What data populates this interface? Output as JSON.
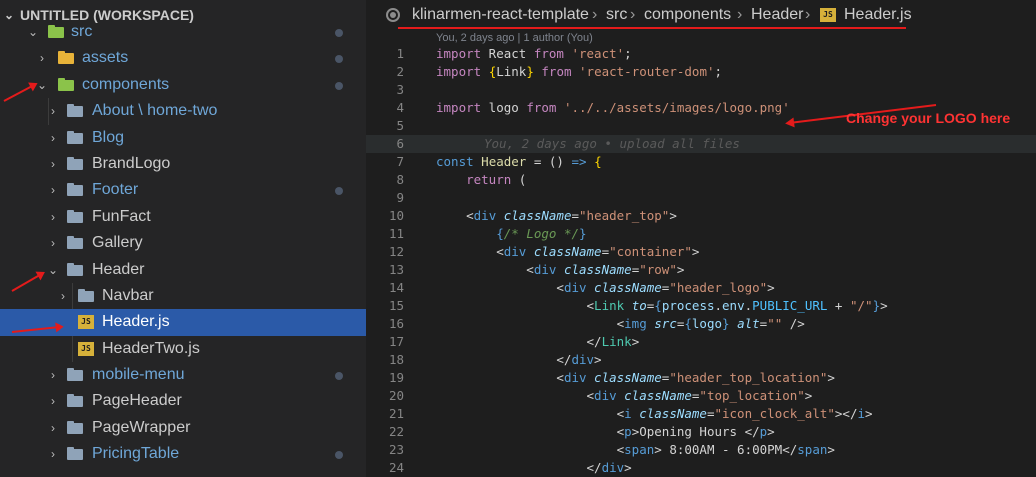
{
  "sidebar": {
    "workspace_title": "UNTITLED (WORKSPACE)",
    "items": [
      {
        "label": "src",
        "kind": "folder",
        "color": "green",
        "expanded": true,
        "level": 1
      },
      {
        "label": "assets",
        "kind": "folder",
        "color": "yellow",
        "expanded": false,
        "level": 2
      },
      {
        "label": "components",
        "kind": "folder",
        "color": "green",
        "expanded": true,
        "level": 2
      },
      {
        "label": "About \\ home-two",
        "kind": "folder",
        "expanded": false,
        "level": 3
      },
      {
        "label": "Blog",
        "kind": "folder",
        "expanded": false,
        "level": 3
      },
      {
        "label": "BrandLogo",
        "kind": "folder",
        "expanded": false,
        "level": 3
      },
      {
        "label": "Footer",
        "kind": "folder",
        "expanded": false,
        "level": 3
      },
      {
        "label": "FunFact",
        "kind": "folder",
        "expanded": false,
        "level": 3
      },
      {
        "label": "Gallery",
        "kind": "folder",
        "expanded": false,
        "level": 3
      },
      {
        "label": "Header",
        "kind": "folder",
        "expanded": true,
        "level": 3
      },
      {
        "label": "Navbar",
        "kind": "folder",
        "expanded": false,
        "level": 4
      },
      {
        "label": "Header.js",
        "kind": "js",
        "level": 4
      },
      {
        "label": "HeaderTwo.js",
        "kind": "js",
        "level": 4
      },
      {
        "label": "mobile-menu",
        "kind": "folder",
        "expanded": false,
        "level": 3
      },
      {
        "label": "PageHeader",
        "kind": "folder",
        "expanded": false,
        "level": 3
      },
      {
        "label": "PageWrapper",
        "kind": "folder",
        "expanded": false,
        "level": 3
      },
      {
        "label": "PricingTable",
        "kind": "folder",
        "expanded": false,
        "level": 3
      }
    ]
  },
  "breadcrumb": {
    "items": [
      "klinarmen-react-template",
      "src",
      "components",
      "Header",
      "Header.js"
    ],
    "js_badge": "JS"
  },
  "editor": {
    "blame_text": "You, 2 days ago | 1 author (You)",
    "ghost_text": "You, 2 days ago • upload all files",
    "lines": [
      {
        "n": "1"
      },
      {
        "n": "2"
      },
      {
        "n": "3"
      },
      {
        "n": "4"
      },
      {
        "n": "5"
      },
      {
        "n": "6"
      },
      {
        "n": "7"
      },
      {
        "n": "8"
      },
      {
        "n": "9"
      },
      {
        "n": "10"
      },
      {
        "n": "11"
      },
      {
        "n": "12"
      },
      {
        "n": "13"
      },
      {
        "n": "14"
      },
      {
        "n": "15"
      },
      {
        "n": "16"
      },
      {
        "n": "17"
      },
      {
        "n": "18"
      },
      {
        "n": "19"
      },
      {
        "n": "20"
      },
      {
        "n": "21"
      },
      {
        "n": "22"
      },
      {
        "n": "23"
      },
      {
        "n": "24"
      }
    ]
  },
  "annotation": {
    "text": "Change your LOGO here",
    "color": "#ff3333"
  },
  "colors": {
    "selection": "#2b5aa8",
    "accent_red": "#e41b1b"
  }
}
